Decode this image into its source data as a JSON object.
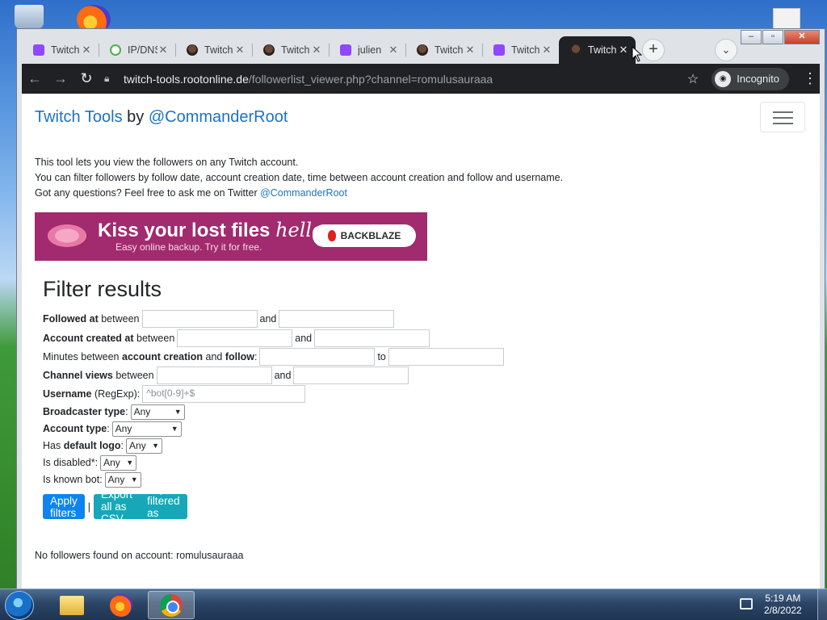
{
  "browser": {
    "tabs": [
      {
        "title": "Twitch",
        "favicon": "twitch-icon"
      },
      {
        "title": "IP/DNS",
        "favicon": "ip-icon"
      },
      {
        "title": "Twitch",
        "favicon": "avatar-icon"
      },
      {
        "title": "Twitch",
        "favicon": "avatar-icon"
      },
      {
        "title": "julien",
        "favicon": "twitch-icon"
      },
      {
        "title": "Twitch",
        "favicon": "avatar-icon"
      },
      {
        "title": "Twitch",
        "favicon": "twitch-icon"
      },
      {
        "title": "Twitch",
        "favicon": "avatar-icon",
        "active": true
      }
    ],
    "url_host": "twitch-tools.rootonline.de",
    "url_path": "/followerlist_viewer.php?channel=romulusauraaa",
    "incognito_label": "Incognito"
  },
  "page": {
    "brand_name": "Twitch Tools",
    "brand_by": "by",
    "brand_handle": "@CommanderRoot",
    "intro_line1": "This tool lets you view the followers on any Twitch account.",
    "intro_line2": "You can filter followers by follow date, account creation date, time between account creation and follow and username.",
    "intro_line3": "Got any questions? Feel free to ask me on Twitter",
    "intro_link": "@CommanderRoot",
    "ad": {
      "headline": "Kiss your lost files",
      "headline_script": "hello",
      "subline": "Easy online backup. Try it for free.",
      "button": "BACKBLAZE"
    },
    "filter_title": "Filter results",
    "filters": {
      "followed_at_label": "Followed at",
      "followed_at_suffix": "between",
      "created_at_label": "Account created at",
      "created_at_suffix": "between",
      "minutes_prefix": "Minutes between",
      "minutes_bold1": "account creation",
      "minutes_and": "and",
      "minutes_bold2": "follow",
      "to": "to",
      "views_label": "Channel views",
      "views_suffix": "between",
      "and": "and",
      "username_label": "Username",
      "username_suffix": "(RegExp):",
      "username_placeholder": "^bot[0-9]+$",
      "broadcaster_label": "Broadcaster type",
      "account_type_label": "Account type",
      "default_logo_prefix": "Has",
      "default_logo_bold": "default logo",
      "disabled_label": "Is disabled",
      "disabled_suffix": "*:",
      "known_bot_label": "Is known bot:",
      "select_any": "Any"
    },
    "buttons": {
      "apply": "Apply filters",
      "separator": "|",
      "export_all": "Export all as CSV",
      "export_filtered": "Export filtered as CSV"
    },
    "result_text": "No followers found on account: romulusauraaa"
  },
  "taskbar": {
    "time": "5:19 AM",
    "date": "2/8/2022"
  },
  "colors": {
    "link": "#1a73c7",
    "primary_button": "#0d84f0",
    "info_button": "#17a7b8",
    "ad_background": "#a22a6e",
    "chrome_dark": "#202124"
  }
}
